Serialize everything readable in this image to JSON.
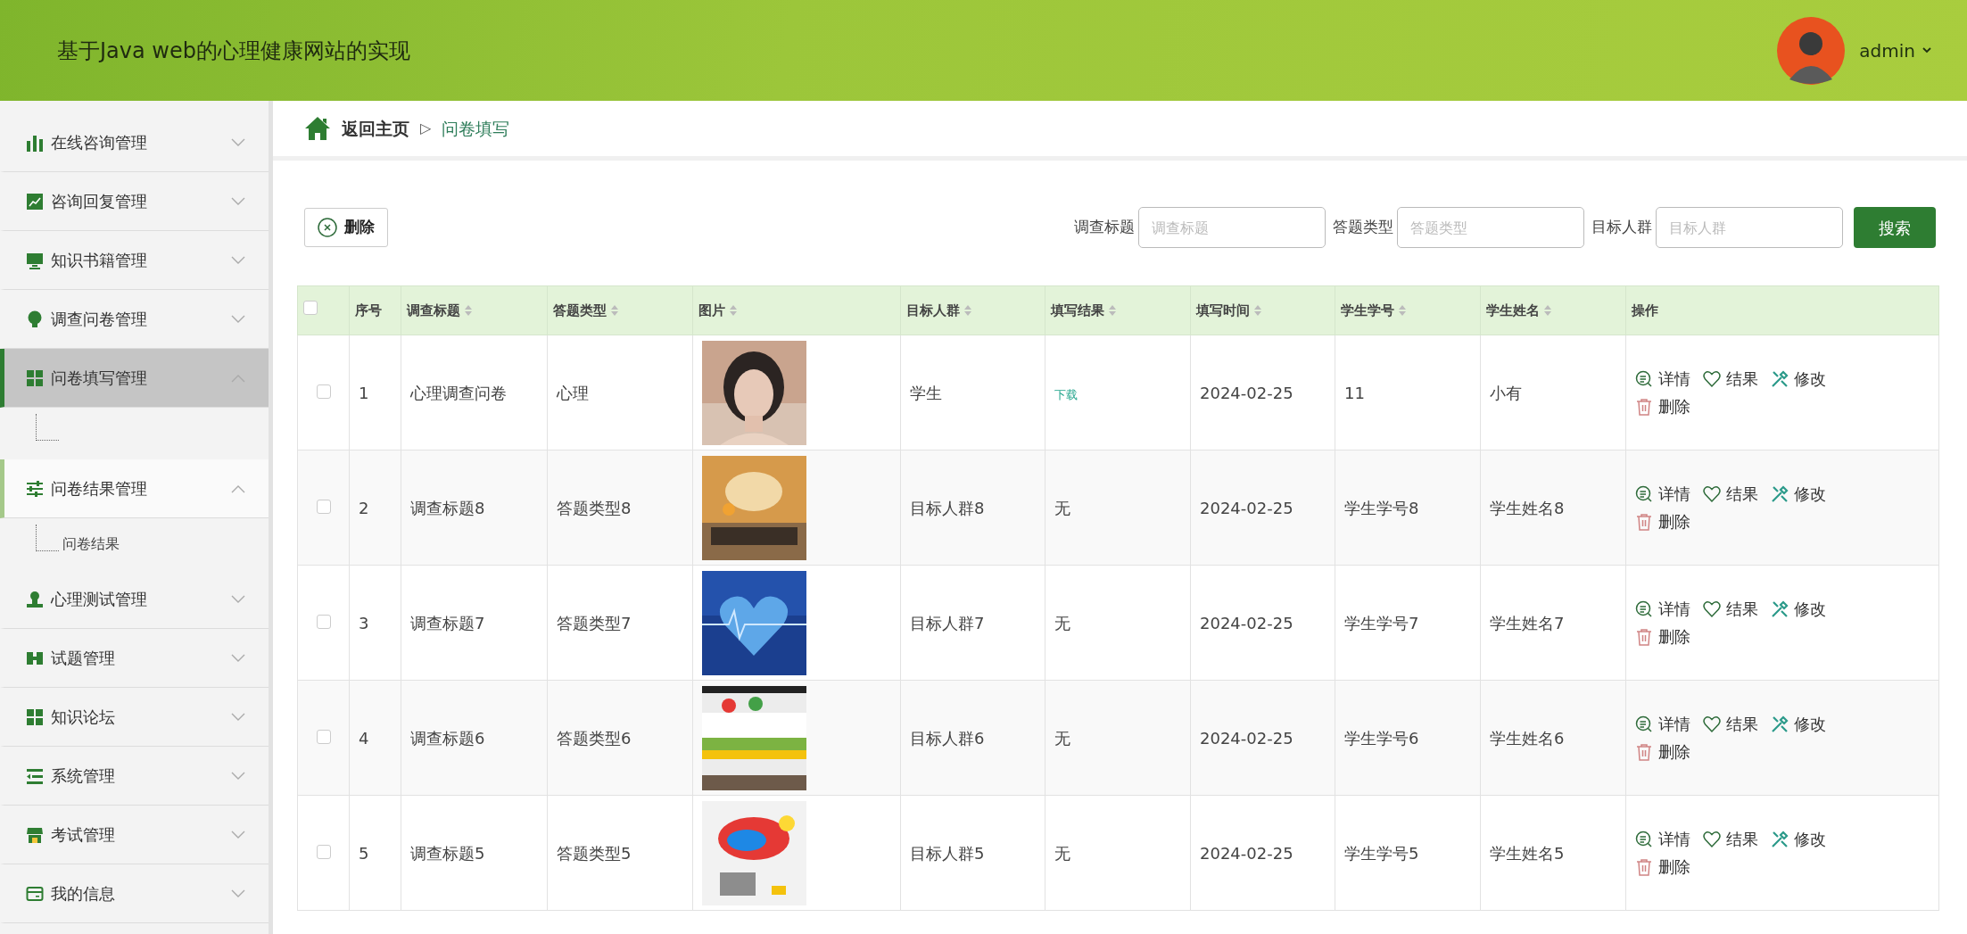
{
  "header": {
    "title": "基于Java web的心理健康网站的实现",
    "user": "admin"
  },
  "sidebar": {
    "items": [
      {
        "label": "在线咨询管理",
        "expanded": false,
        "selected": false
      },
      {
        "label": "咨询回复管理",
        "expanded": false,
        "selected": false
      },
      {
        "label": "知识书籍管理",
        "expanded": false,
        "selected": false
      },
      {
        "label": "调查问卷管理",
        "expanded": false,
        "selected": false
      },
      {
        "label": "问卷填写管理",
        "expanded": true,
        "selected": true
      },
      {
        "label": "问卷结果管理",
        "expanded": true,
        "selected": false,
        "children": [
          {
            "label": "问卷结果"
          }
        ]
      },
      {
        "label": "心理测试管理",
        "expanded": false,
        "selected": false
      },
      {
        "label": "试题管理",
        "expanded": false,
        "selected": false
      },
      {
        "label": "知识论坛",
        "expanded": false,
        "selected": false
      },
      {
        "label": "系统管理",
        "expanded": false,
        "selected": false
      },
      {
        "label": "考试管理",
        "expanded": false,
        "selected": false
      },
      {
        "label": "我的信息",
        "expanded": false,
        "selected": false
      }
    ]
  },
  "breadcrumb": {
    "home": "返回主页",
    "separator": "▷",
    "current": "问卷填写"
  },
  "toolbar": {
    "delete_button": "删除",
    "filters": [
      {
        "label": "调查标题",
        "placeholder": "调查标题"
      },
      {
        "label": "答题类型",
        "placeholder": "答题类型"
      },
      {
        "label": "目标人群",
        "placeholder": "目标人群"
      }
    ],
    "search_button": "搜索"
  },
  "table": {
    "select_all": {
      "checked": false
    },
    "columns": [
      {
        "label": "序号",
        "sortable": false
      },
      {
        "label": "调查标题",
        "sortable": true
      },
      {
        "label": "答题类型",
        "sortable": true
      },
      {
        "label": "图片",
        "sortable": true
      },
      {
        "label": "目标人群",
        "sortable": true
      },
      {
        "label": "填写结果",
        "sortable": true
      },
      {
        "label": "填写时间",
        "sortable": true
      },
      {
        "label": "学生学号",
        "sortable": true
      },
      {
        "label": "学生姓名",
        "sortable": true
      },
      {
        "label": "操作",
        "sortable": false
      }
    ],
    "rows": [
      {
        "checked": false,
        "index": "1",
        "title": "心理调查问卷",
        "type": "心理",
        "image": {
          "kind": "picture"
        },
        "audience": "学生",
        "result": {
          "kind": "link",
          "text": "下载"
        },
        "time": "2024-02-25",
        "student_no": "11",
        "student_name": "小有",
        "actions": [
          "详情",
          "结果",
          "修改",
          "删除"
        ]
      },
      {
        "checked": false,
        "index": "2",
        "title": "调查标题8",
        "type": "答题类型8",
        "image": {
          "kind": "picture"
        },
        "audience": "目标人群8",
        "result": {
          "kind": "text",
          "text": "无"
        },
        "time": "2024-02-25",
        "student_no": "学生学号8",
        "student_name": "学生姓名8",
        "actions": [
          "详情",
          "结果",
          "修改",
          "删除"
        ]
      },
      {
        "checked": false,
        "index": "3",
        "title": "调查标题7",
        "type": "答题类型7",
        "image": {
          "kind": "picture"
        },
        "audience": "目标人群7",
        "result": {
          "kind": "text",
          "text": "无"
        },
        "time": "2024-02-25",
        "student_no": "学生学号7",
        "student_name": "学生姓名7",
        "actions": [
          "详情",
          "结果",
          "修改",
          "删除"
        ]
      },
      {
        "checked": false,
        "index": "4",
        "title": "调查标题6",
        "type": "答题类型6",
        "image": {
          "kind": "picture"
        },
        "audience": "目标人群6",
        "result": {
          "kind": "text",
          "text": "无"
        },
        "time": "2024-02-25",
        "student_no": "学生学号6",
        "student_name": "学生姓名6",
        "actions": [
          "详情",
          "结果",
          "修改",
          "删除"
        ]
      },
      {
        "checked": false,
        "index": "5",
        "title": "调查标题5",
        "type": "答题类型5",
        "image": {
          "kind": "picture"
        },
        "audience": "目标人群5",
        "result": {
          "kind": "text",
          "text": "无"
        },
        "time": "2024-02-25",
        "student_no": "学生学号5",
        "student_name": "学生姓名5",
        "actions": [
          "详情",
          "结果",
          "修改",
          "删除"
        ]
      }
    ]
  }
}
